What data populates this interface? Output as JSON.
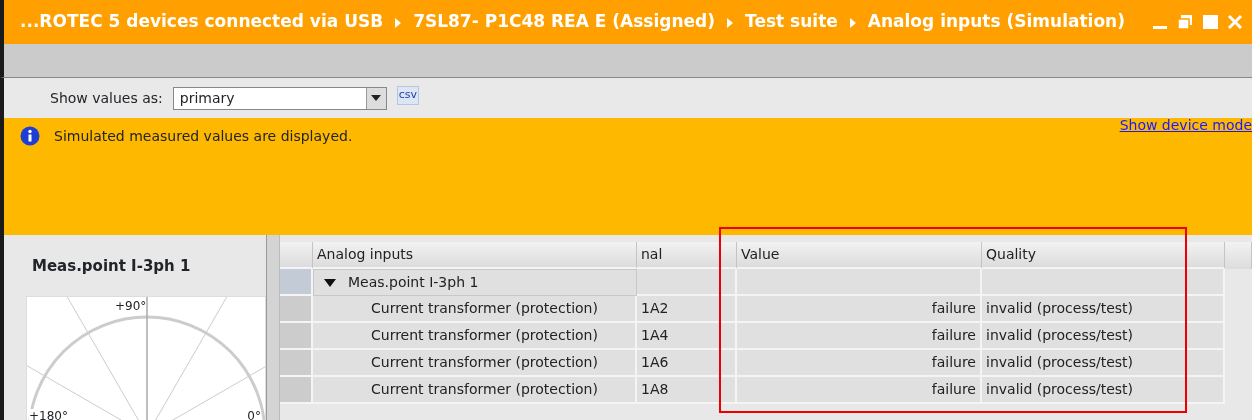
{
  "window": {
    "breadcrumb": [
      "...ROTEC 5 devices connected via USB",
      "7SL87- P1C48 REA E (Assigned)",
      "Test suite",
      "Analog inputs (Simulation)"
    ]
  },
  "toolbar": {
    "label": "Show values as:",
    "select_value": "primary",
    "export_label": "csv"
  },
  "info_bar": {
    "message": "Simulated measured values are displayed.",
    "link": "Show device mode"
  },
  "phasor_panel": {
    "title": "Meas.point I-3ph 1",
    "axis_labels": [
      "+90°",
      "+180°",
      "0°"
    ]
  },
  "table": {
    "columns": [
      "Analog inputs",
      "nal",
      "Value",
      "Quality"
    ],
    "rows": [
      {
        "name": "Meas.point I-3ph 1",
        "expanded": true,
        "children": [
          {
            "name": "Current transformer (protection)",
            "signal": "1A2",
            "value": "failure",
            "quality": "invalid (process/test)"
          },
          {
            "name": "Current transformer (protection)",
            "signal": "1A4",
            "value": "failure",
            "quality": "invalid (process/test)"
          },
          {
            "name": "Current transformer (protection)",
            "signal": "1A6",
            "value": "failure",
            "quality": "invalid (process/test)"
          },
          {
            "name": "Current transformer (protection)",
            "signal": "1A8",
            "value": "failure",
            "quality": "invalid (process/test)"
          }
        ]
      }
    ]
  }
}
